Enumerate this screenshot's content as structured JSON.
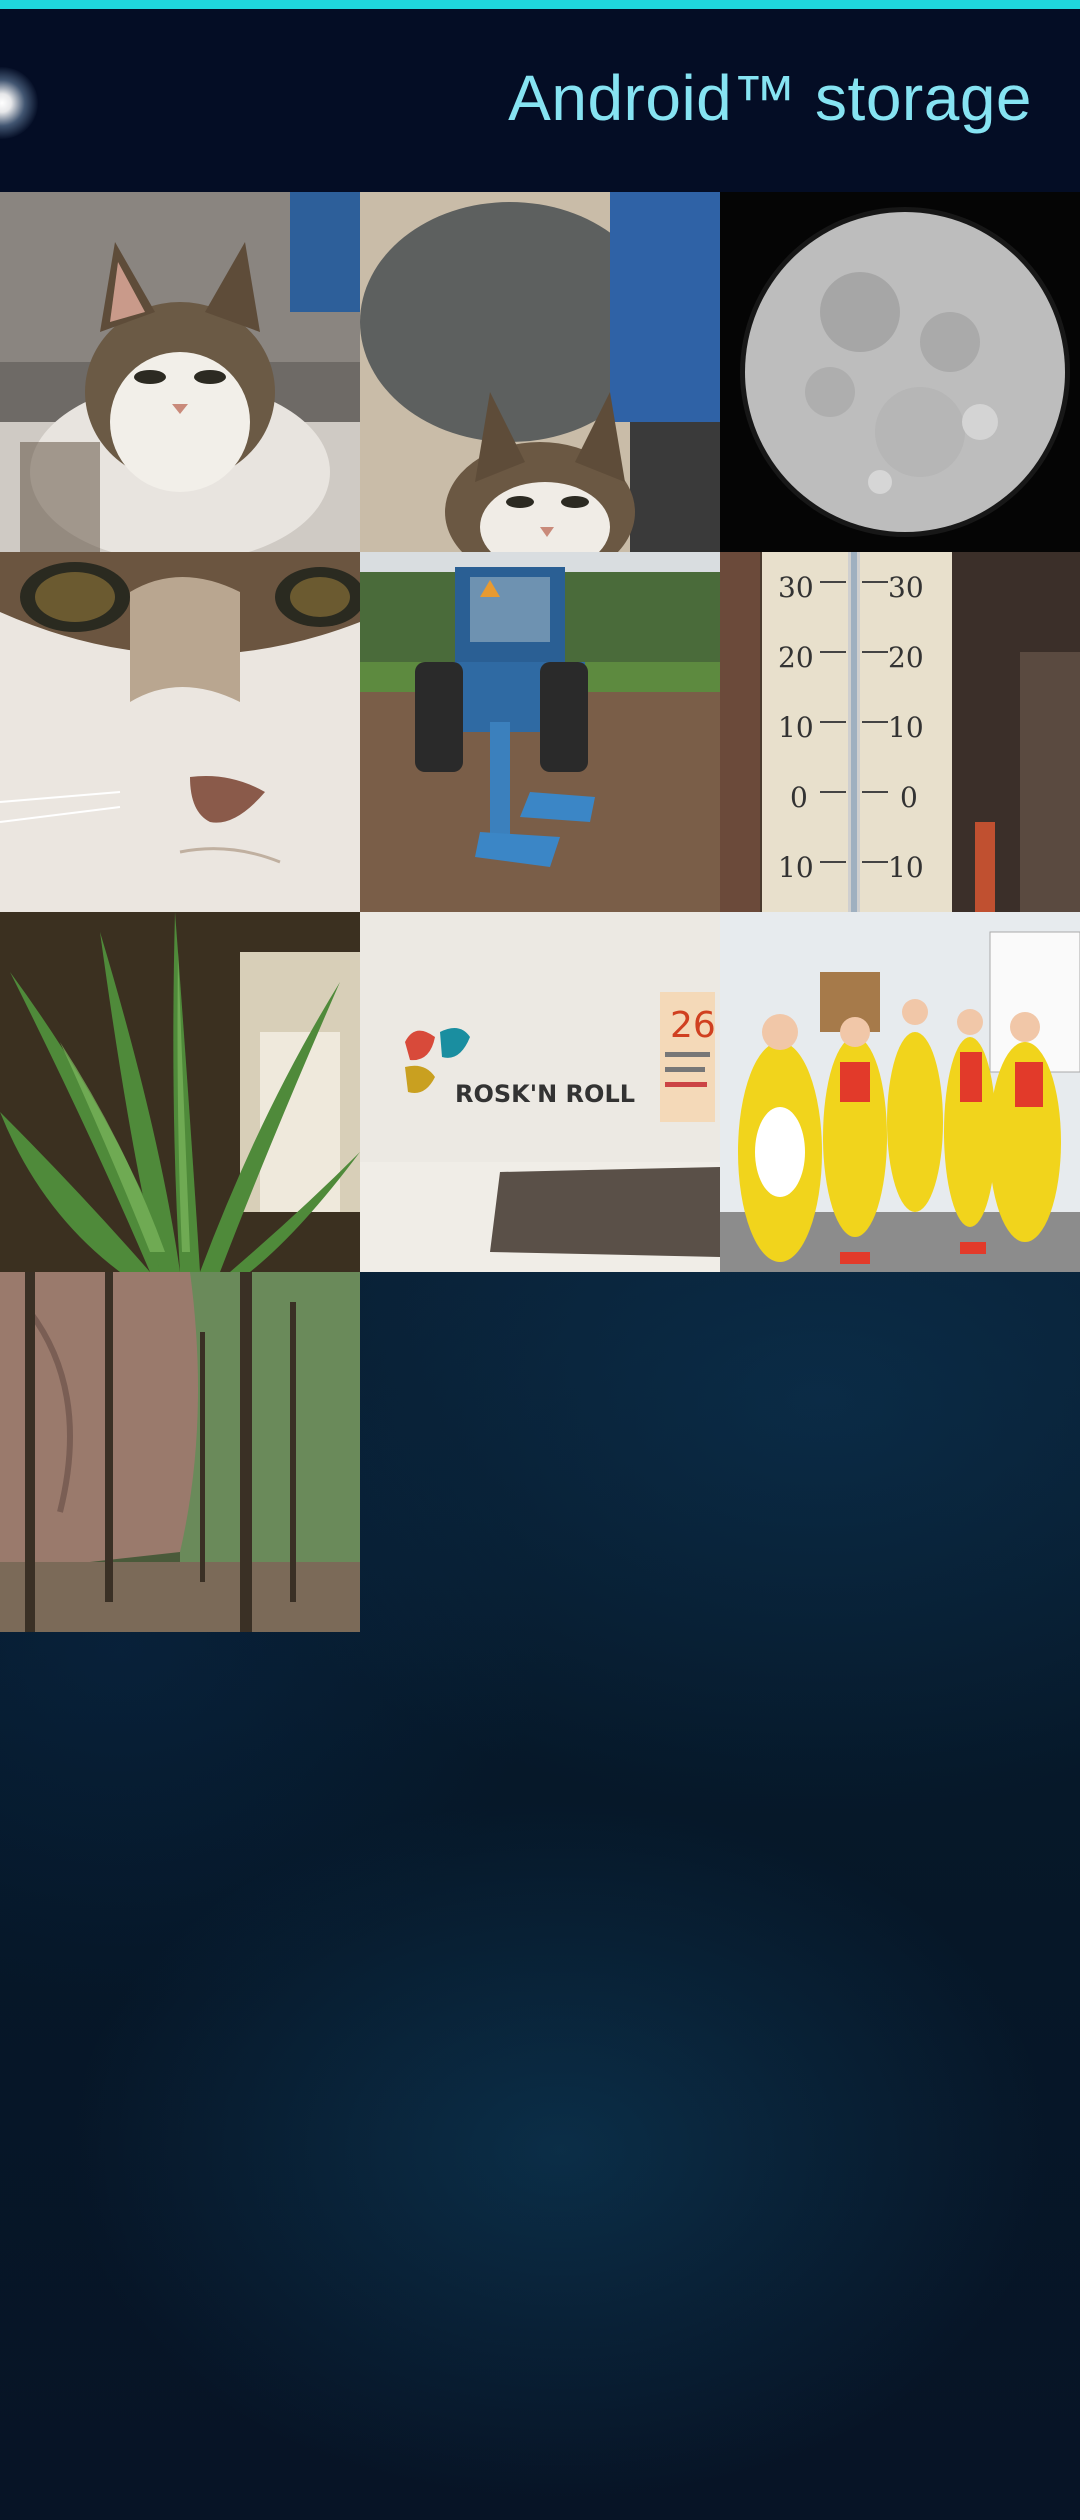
{
  "header": {
    "title": "Android™ storage",
    "accent_color": "#1fd6dc",
    "title_color": "#86e3f2"
  },
  "gallery": {
    "items": [
      {
        "subject": "cat-portrait"
      },
      {
        "subject": "cat-peeking"
      },
      {
        "subject": "full-moon"
      },
      {
        "subject": "cat-closeup"
      },
      {
        "subject": "blue-tractor-plow"
      },
      {
        "subject": "thermometer"
      },
      {
        "subject": "aloe-plant"
      },
      {
        "subject": "rosk-n-roll-sign",
        "logo_text": "ROSK'N ROLL",
        "calendar_number": "26"
      },
      {
        "subject": "people-in-yellow-costumes"
      },
      {
        "subject": "forest-cliff"
      }
    ]
  }
}
